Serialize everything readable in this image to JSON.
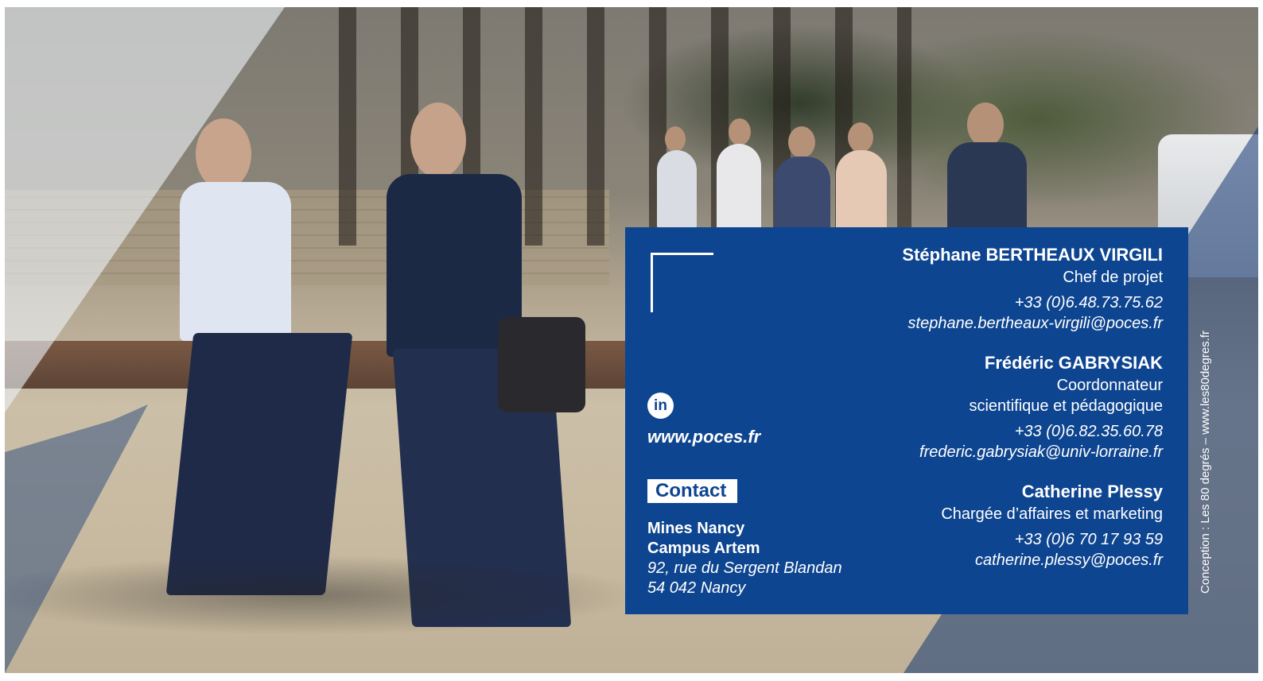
{
  "contacts": [
    {
      "name": "Stéphane BERTHEAUX VIRGILI",
      "role_lines": [
        "Chef de projet"
      ],
      "phone": "+33 (0)6.48.73.75.62",
      "email": "stephane.bertheaux-virgili@poces.fr"
    },
    {
      "name": "Frédéric GABRYSIAK",
      "role_lines": [
        "Coordonnateur",
        "scientifique et pédagogique"
      ],
      "phone": "+33 (0)6.82.35.60.78",
      "email": "frederic.gabrysiak@univ-lorraine.fr"
    },
    {
      "name": "Catherine Plessy",
      "role_lines": [
        "Chargée d’affaires et marketing"
      ],
      "phone": "+33 (0)6 70 17 93 59",
      "email": "catherine.plessy@poces.fr"
    }
  ],
  "social": {
    "linkedin_glyph": "in",
    "website": "www.poces.fr"
  },
  "contact_label": "Contact",
  "address": {
    "line1": "Mines Nancy",
    "line2": "Campus Artem",
    "line3": "92, rue du Sergent Blandan",
    "line4": "54 042 Nancy"
  },
  "credit": "Conception : Les 80 degrés – www.les80degres.fr",
  "colors": {
    "card_background": "#0e4590",
    "text": "#ffffff"
  }
}
